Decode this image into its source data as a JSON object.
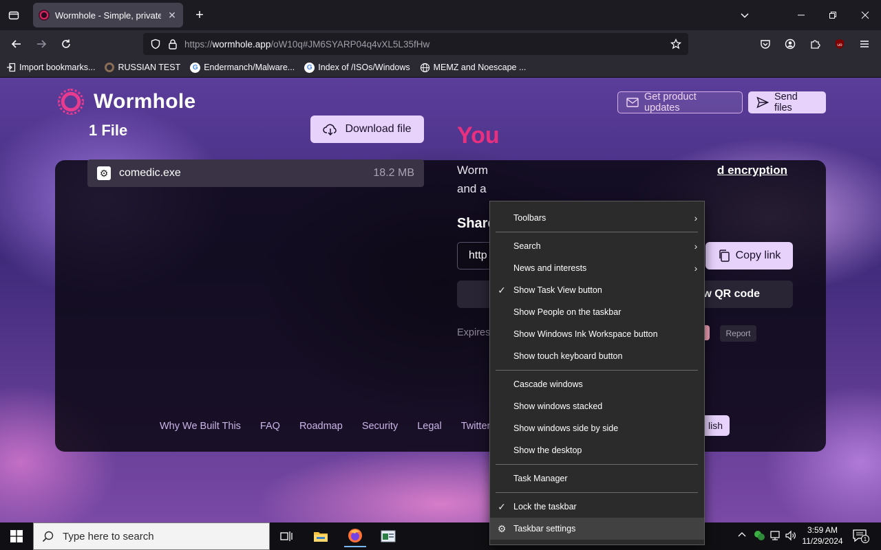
{
  "browser": {
    "tab_title": "Wormhole - Simple, private file",
    "url_prefix": "https://",
    "url_domain": "wormhole.app",
    "url_rest": "/oW10q#JM6SYARP04q4vXL5L35fHw",
    "bookmarks": [
      {
        "label": "Import bookmarks...",
        "icon": "import-icon"
      },
      {
        "label": "RUSSIAN TEST",
        "icon": "ring-icon"
      },
      {
        "label": "Endermanch/Malware...",
        "icon": "google-icon"
      },
      {
        "label": "Index of /ISOs/Windows",
        "icon": "google-icon"
      },
      {
        "label": "MEMZ and Noescape ...",
        "icon": "globe-icon"
      }
    ]
  },
  "site": {
    "logo_text": "Wormhole",
    "updates_label": "Get product updates",
    "send_label": "Send files"
  },
  "files": {
    "title": "1 File",
    "download_label": "Download file",
    "items": [
      {
        "name": "comedic.exe",
        "size": "18.2 MB"
      }
    ]
  },
  "share": {
    "heading_visible": "You",
    "desc_line1_start": "Worm",
    "desc_link_part": "d encryption",
    "desc_line2_start": "and a",
    "share_label": "Share",
    "input_visible": "http",
    "copy_label": "Copy link",
    "qr_label": "w QR code",
    "expires_visible": "Expires",
    "report_label": "Report"
  },
  "footer": {
    "links": [
      "Why We Built This",
      "FAQ",
      "Roadmap",
      "Security",
      "Legal",
      "Twitter"
    ],
    "language_visible": "lish"
  },
  "context_menu": {
    "items": [
      {
        "label": "Toolbars",
        "checked": false,
        "submenu": true
      },
      {
        "label": "Search",
        "checked": false,
        "submenu": true
      },
      {
        "label": "News and interests",
        "checked": false,
        "submenu": true
      },
      {
        "label": "Show Task View button",
        "checked": true,
        "submenu": false
      },
      {
        "label": "Show People on the taskbar",
        "checked": false,
        "submenu": false
      },
      {
        "label": "Show Windows Ink Workspace button",
        "checked": false,
        "submenu": false
      },
      {
        "label": "Show touch keyboard button",
        "checked": false,
        "submenu": false
      },
      {
        "label": "Cascade windows",
        "checked": false,
        "submenu": false
      },
      {
        "label": "Show windows stacked",
        "checked": false,
        "submenu": false
      },
      {
        "label": "Show windows side by side",
        "checked": false,
        "submenu": false
      },
      {
        "label": "Show the desktop",
        "checked": false,
        "submenu": false
      },
      {
        "label": "Task Manager",
        "checked": false,
        "submenu": false
      },
      {
        "label": "Lock the taskbar",
        "checked": true,
        "submenu": false
      },
      {
        "label": "Taskbar settings",
        "checked": false,
        "submenu": false,
        "icon": "gear-icon",
        "highlighted": true
      }
    ]
  },
  "taskbar": {
    "search_placeholder": "Type here to search",
    "time": "3:59 AM",
    "date": "11/29/2024",
    "notification_count": "1"
  },
  "colors": {
    "accent_pink": "#e8307f",
    "button_lilac": "#e6d2fb",
    "menu_bg": "#2b2b2b"
  }
}
